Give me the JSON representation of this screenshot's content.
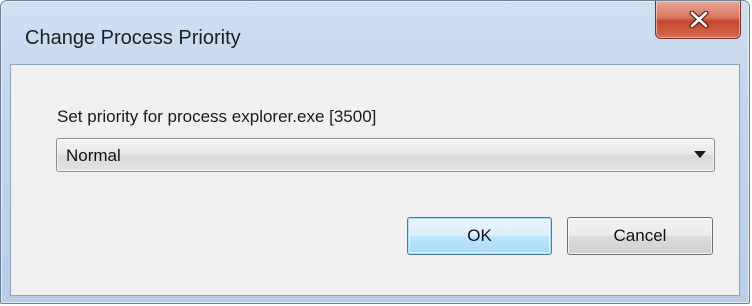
{
  "window": {
    "title": "Change Process Priority",
    "close_icon": "close-x-icon"
  },
  "dialog": {
    "prompt": "Set priority for process explorer.exe [3500]",
    "priority_select": {
      "selected": "Normal",
      "arrow_icon": "chevron-down-icon"
    },
    "ok_label": "OK",
    "cancel_label": "Cancel"
  },
  "colors": {
    "close_button": "#c4472e",
    "ok_button_border": "#3c7fb1",
    "frame": "#c2d6ec"
  }
}
